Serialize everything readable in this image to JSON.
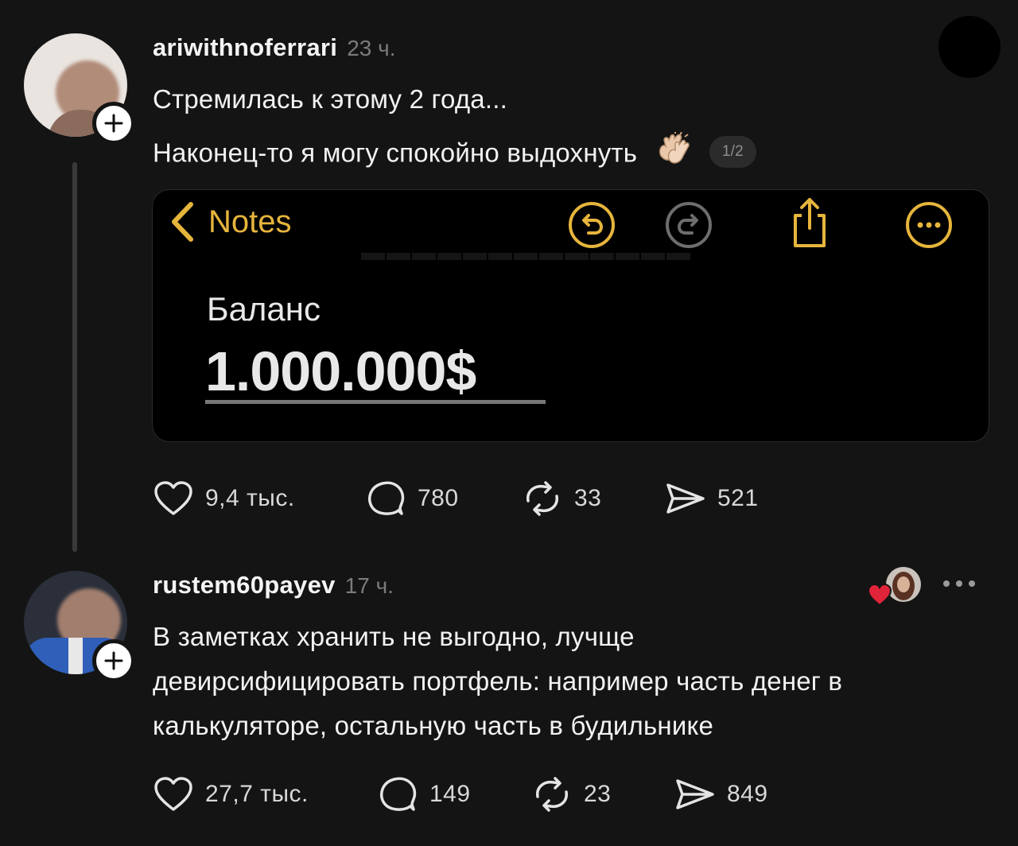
{
  "post1": {
    "username": "ariwithnoferrari",
    "time": "23 ч.",
    "line1": "Стремилась к этому 2 года...",
    "line2": "Наконец-то я могу спокойно выдохнуть",
    "page_indicator": "1/2",
    "media": {
      "back_label": "Notes",
      "balance_label": "Баланс",
      "balance_value": "1.000.000$",
      "accent_color": "#e6b53c"
    },
    "actions": {
      "likes": "9,4 тыс.",
      "replies": "780",
      "reposts": "33",
      "shares": "521"
    }
  },
  "post2": {
    "username": "rustem60payev",
    "time": "17 ч.",
    "lines": [
      "В заметках хранить не выгодно, лучще",
      "девирсифицировать портфель: например часть денег в",
      "калькуляторе, остальную часть в будильнике"
    ],
    "actions": {
      "likes": "27,7 тыс.",
      "replies": "149",
      "reposts": "23",
      "shares": "849"
    }
  },
  "colors": {
    "background": "#141414",
    "text": "#f2f2f2",
    "muted": "#7b7b7b",
    "like_red": "#e0243a"
  }
}
